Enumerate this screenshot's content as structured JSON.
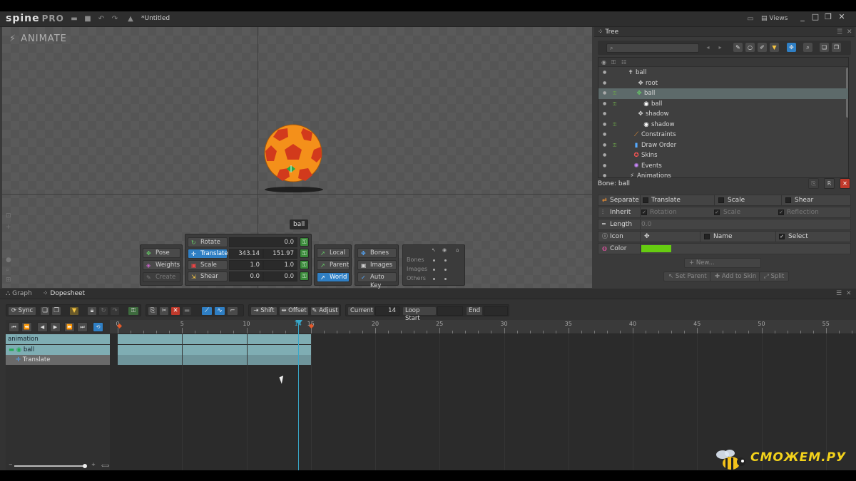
{
  "app": {
    "logo": "spine",
    "edition": "PRO",
    "title": "*Untitled",
    "views_label": "Views"
  },
  "viewport": {
    "mode_label": "ANIMATE",
    "bone_tag": "ball"
  },
  "transform": {
    "pose": "Pose",
    "weights": "Weights",
    "create": "Create",
    "rotate": {
      "label": "Rotate",
      "value": "0.0"
    },
    "translate": {
      "label": "Translate",
      "x": "343.14",
      "y": "151.97"
    },
    "scale": {
      "label": "Scale",
      "x": "1.0",
      "y": "1.0"
    },
    "shear": {
      "label": "Shear",
      "x": "0.0",
      "y": "0.0"
    },
    "axes": {
      "local": "Local",
      "parent": "Parent",
      "world": "World"
    },
    "keys": {
      "bones": "Bones",
      "images": "Images",
      "auto_key": "Auto Key"
    },
    "visibility": {
      "bones": "Bones",
      "images": "Images",
      "others": "Others"
    }
  },
  "tree": {
    "tab_label": "Tree",
    "search_placeholder": "",
    "rows": [
      {
        "label": "ball",
        "indent": 0,
        "selected": false
      },
      {
        "label": "root",
        "indent": 1,
        "selected": false
      },
      {
        "label": "ball",
        "indent": 2,
        "selected": true
      },
      {
        "label": "ball",
        "indent": 3,
        "selected": false
      },
      {
        "label": "shadow",
        "indent": 2,
        "selected": false
      },
      {
        "label": "shadow",
        "indent": 3,
        "selected": false
      },
      {
        "label": "Constraints",
        "indent": 1,
        "selected": false
      },
      {
        "label": "Draw Order",
        "indent": 1,
        "selected": false
      },
      {
        "label": "Skins",
        "indent": 1,
        "selected": false
      },
      {
        "label": "Events",
        "indent": 1,
        "selected": false
      },
      {
        "label": "Animations",
        "indent": 1,
        "selected": false
      }
    ]
  },
  "bone": {
    "header": "Bone: ball",
    "separate": "Separate",
    "translate": "Translate",
    "scale": "Scale",
    "shear": "Shear",
    "inherit": "Inherit",
    "rotation": "Rotation",
    "inherit_scale": "Scale",
    "reflection": "Reflection",
    "length": "Length",
    "length_value": "0.0",
    "icon": "Icon",
    "name": "Name",
    "select": "Select",
    "color": "Color",
    "color_value": "#66cc11",
    "new_btn": "New...",
    "set_parent": "Set Parent",
    "add_to_skin": "Add to Skin",
    "split": "Split"
  },
  "dock": {
    "tab_graph": "Graph",
    "tab_dopesheet": "Dopesheet",
    "sync": "Sync",
    "shift": "Shift",
    "offset": "Offset",
    "adjust": "Adjust",
    "current_label": "Current",
    "current_value": "14",
    "loop_start_label": "Loop Start",
    "end_label": "End"
  },
  "timeline": {
    "ruler": [
      "0",
      "5",
      "10",
      "14",
      "15",
      "20",
      "25",
      "30",
      "35",
      "40",
      "45",
      "50",
      "55"
    ],
    "tracks": [
      {
        "label": "animation"
      },
      {
        "label": "ball"
      },
      {
        "label": "Translate"
      }
    ]
  },
  "watermark": {
    "text": "СМОЖЕМ.РУ"
  },
  "colors": {
    "accent": "#2f7fc4",
    "key_green": "#3a8a3a",
    "track": "#7fadb3",
    "playhead": "#39a7c9",
    "keyframe": "#e55a2b"
  }
}
